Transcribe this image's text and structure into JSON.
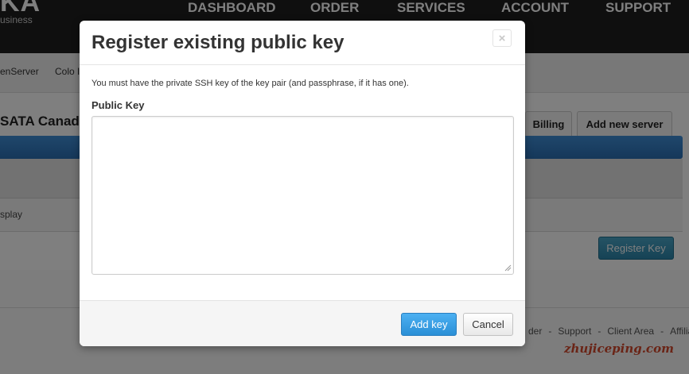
{
  "header": {
    "logo": "KA",
    "logo_sub": "usiness",
    "nav": [
      "DASHBOARD",
      "ORDER",
      "SERVICES",
      "ACCOUNT",
      "SUPPORT"
    ]
  },
  "subnav": {
    "items": [
      "enServer",
      "Colo I"
    ]
  },
  "page": {
    "title": "SATA Canada",
    "tabs": [
      "Billing",
      "Add new server"
    ],
    "row_text": "splay",
    "register_key_label": "Register Key"
  },
  "footer": {
    "links": [
      "der",
      "Support",
      "Client Area",
      "Affiliates"
    ],
    "separator": "-"
  },
  "watermark": "zhujiceping.com",
  "modal": {
    "title": "Register existing public key",
    "close_icon": "×",
    "description": "You must have the private SSH key of the key pair (and passphrase, if it has one).",
    "field_label": "Public Key",
    "public_key_value": "",
    "add_key_label": "Add key",
    "cancel_label": "Cancel"
  },
  "colors": {
    "accent": "#2a8fd6",
    "topbar": "#1f1f1f",
    "register_key": "#2c86ab",
    "watermark": "#d4492d"
  }
}
